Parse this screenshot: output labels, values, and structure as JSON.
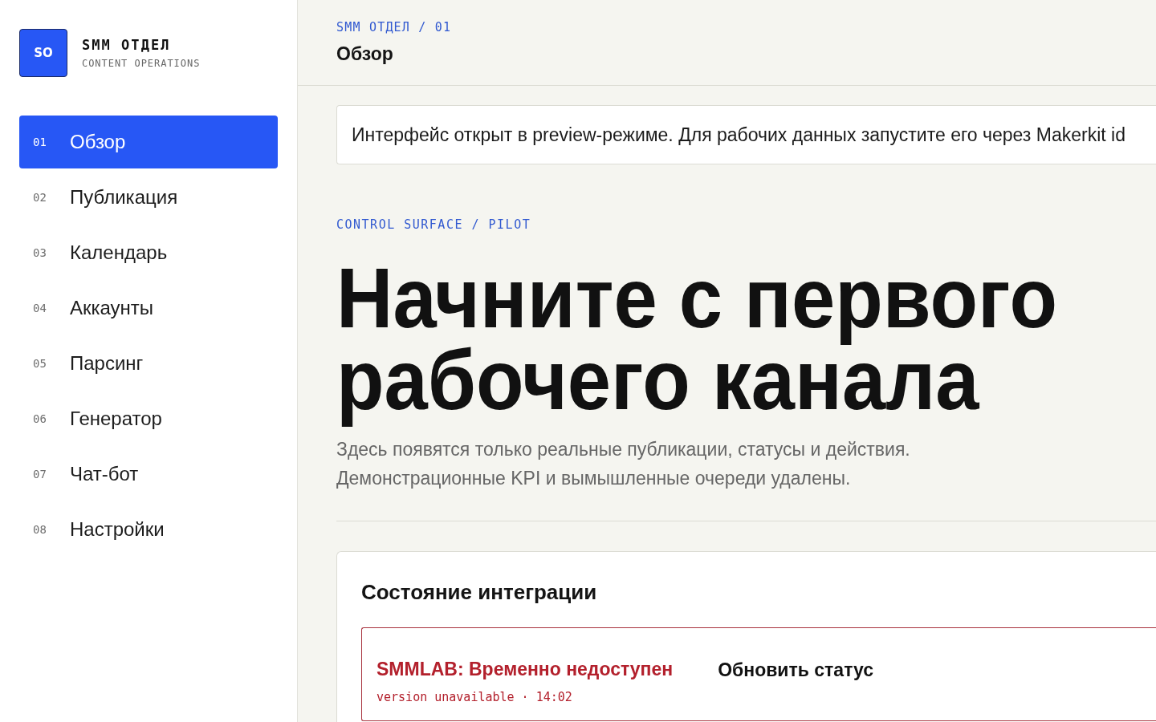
{
  "sidebar": {
    "logo": {
      "initials": "SO",
      "title": "SMM ОТДЕЛ",
      "subtitle": "CONTENT OPERATIONS"
    },
    "items": [
      {
        "number": "01",
        "label": "Обзор",
        "selected": true
      },
      {
        "number": "02",
        "label": "Публикация",
        "selected": false
      },
      {
        "number": "03",
        "label": "Календарь",
        "selected": false
      },
      {
        "number": "04",
        "label": "Аккаунты",
        "selected": false
      },
      {
        "number": "05",
        "label": "Парсинг",
        "selected": false
      },
      {
        "number": "06",
        "label": "Генератор",
        "selected": false
      },
      {
        "number": "07",
        "label": "Чат-бот",
        "selected": false
      },
      {
        "number": "08",
        "label": "Настройки",
        "selected": false
      }
    ]
  },
  "header": {
    "breadcrumb": "SMM ОТДЕЛ / 01",
    "title": "Обзор"
  },
  "notice": "Интерфейс открыт в preview-режиме. Для рабочих данных запустите его через Makerkit id",
  "hero": {
    "eyebrow": "CONTROL SURFACE / PILOT",
    "heading": "Начните с первого рабочего канала",
    "description": "Здесь появятся только реальные публикации, статусы и действия. Демонстрационные KPI и вымышленные очереди удалены."
  },
  "integration": {
    "title": "Состояние интеграции",
    "services": [
      {
        "name": "SMMLAB: Временно недоступен",
        "detail": "version unavailable · 14:02",
        "error": true,
        "action": "Обновить статус"
      }
    ]
  }
}
